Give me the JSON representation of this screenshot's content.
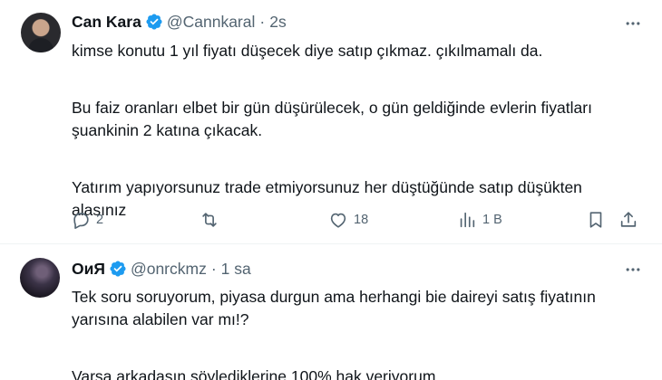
{
  "tweets": [
    {
      "name": "Can Kara",
      "handle": "@Cannkaral",
      "separator": "·",
      "time": "2s",
      "paragraphs": [
        [
          "kimse konutu 1 yıl fiyatı düşecek diye satıp çıkmaz. çıkılmamalı da."
        ],
        [
          "Bu faiz oranları elbet bir gün düşürülecek, o gün geldiğinde evlerin fiyatları",
          "şuankinin 2 katına çıkacak."
        ],
        [
          "Yatırım yapıyorsunuz trade etmiyorsunuz her düştüğünde satıp düşükten",
          "alasınız"
        ]
      ],
      "actions": {
        "replies": "2",
        "retweets": "",
        "likes": "18",
        "views": "1 B"
      },
      "icons": [
        "reply-icon",
        "retweet-icon",
        "like-icon",
        "views-icon",
        "bookmark-icon",
        "share-icon",
        "more-icon",
        "verified-badge-icon"
      ]
    },
    {
      "name": "ОиЯ",
      "handle": "@onrckmz",
      "separator": "·",
      "time": "1 sa",
      "paragraphs": [
        [
          "Tek soru soruyorum, piyasa durgun ama herhangi bie daireyi satış fiyatının",
          "yarısına alabilen var mı!?"
        ],
        [
          "Varsa arkadaşın söylediklerine 100% hak veriyorum..."
        ]
      ],
      "icons": [
        "more-icon",
        "verified-badge-icon"
      ]
    }
  ],
  "colors": {
    "text": "#0f1419",
    "secondary": "#536471",
    "verified_blue": "#1d9bf0",
    "divider": "#eff3f4"
  }
}
